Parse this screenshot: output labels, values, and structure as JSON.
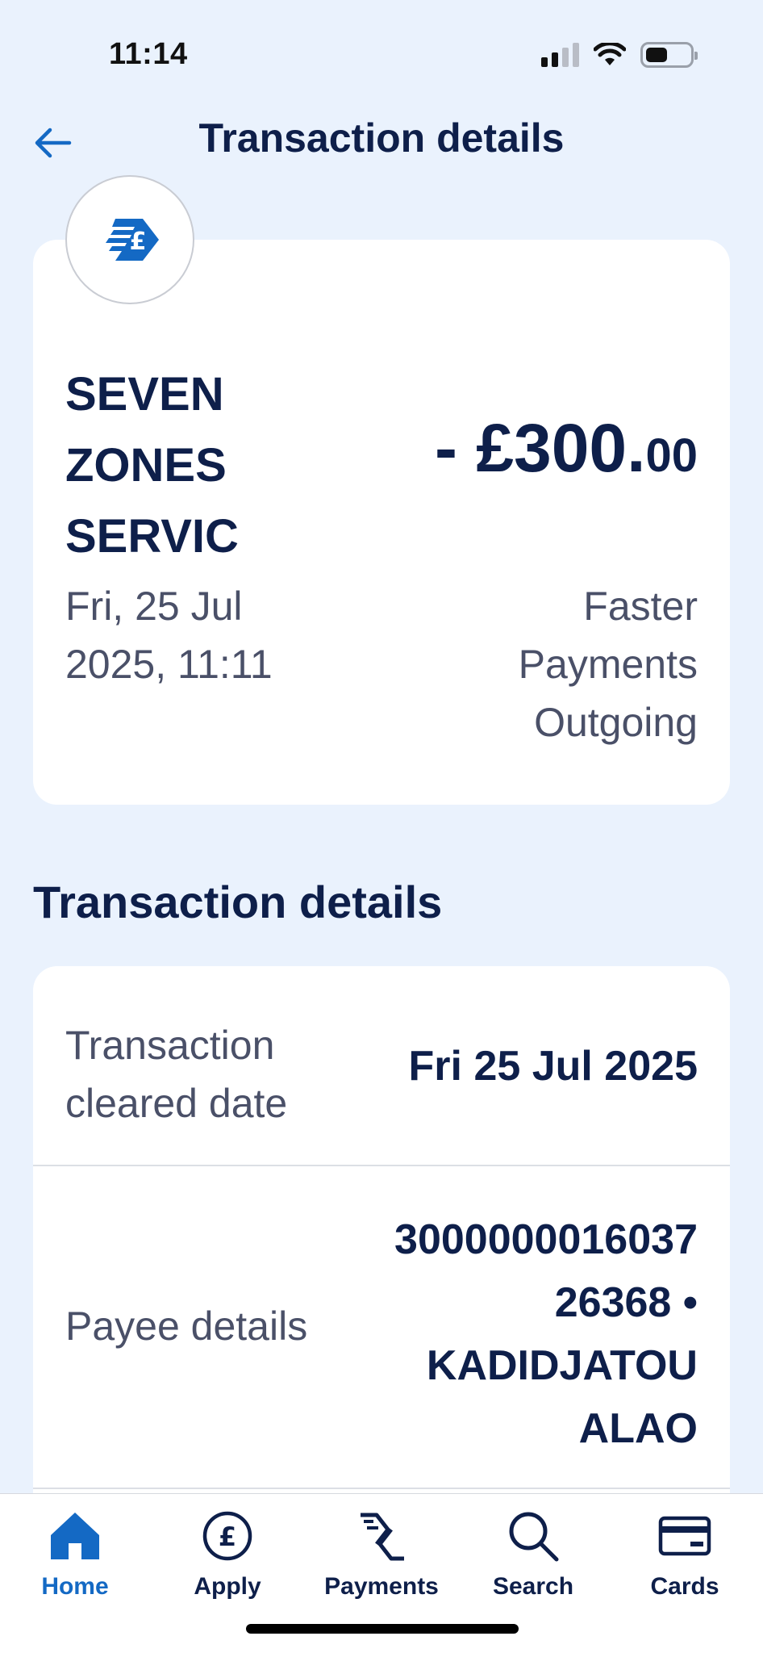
{
  "status_bar": {
    "time": "11:14"
  },
  "header": {
    "title": "Transaction details"
  },
  "summary": {
    "merchant_line1": "SEVEN",
    "merchant_line2": "ZONES",
    "merchant_line3": "SERVIC",
    "amount_sign": "- £",
    "amount_whole": "300.",
    "amount_pence": "00",
    "date_line1": "Fri, 25 Jul",
    "date_line2": "2025, 11:11",
    "type_line1": "Faster",
    "type_line2": "Payments",
    "type_line3": "Outgoing"
  },
  "details": {
    "section_title": "Transaction details",
    "rows": [
      {
        "label_line1": "Transaction",
        "label_line2": "cleared date",
        "value": "Fri 25 Jul 2025"
      },
      {
        "label": "Payee details",
        "value_line1": "3000000016037",
        "value_line2": "26368 •",
        "value_line3": "KADIDJATOU",
        "value_line4": "ALAO"
      }
    ]
  },
  "nav": {
    "items": [
      {
        "label": "Home",
        "icon": "home-icon",
        "active": true
      },
      {
        "label": "Apply",
        "icon": "pound-circle-icon"
      },
      {
        "label": "Payments",
        "icon": "payments-arrows-icon"
      },
      {
        "label": "Search",
        "icon": "search-icon"
      },
      {
        "label": "Cards",
        "icon": "card-icon"
      }
    ]
  },
  "colors": {
    "background": "#eaf2fd",
    "primary_text": "#0e1f4a",
    "accent": "#1469c4",
    "secondary_text": "#4a5068"
  }
}
